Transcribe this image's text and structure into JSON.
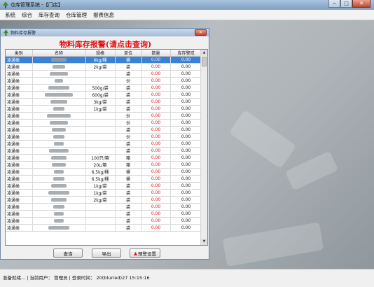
{
  "window": {
    "title": "仓库管理系统 -【门店】",
    "controls": {
      "minimize": "−",
      "maximize": "□",
      "close": "✕"
    }
  },
  "menu": [
    "系统",
    "综合",
    "库存查询",
    "仓库管理",
    "报表信息"
  ],
  "child_window": {
    "title": "物料库存报警",
    "close": "✕",
    "header": "物料库存报警(请点击查询)"
  },
  "table": {
    "columns": [
      "类别",
      "名称",
      "规格",
      "单位",
      "数量",
      "库存警戒"
    ],
    "rows": [
      {
        "cat": "凌通类",
        "name": "(blurred)",
        "spec": "6kg/桶",
        "unit": "桶",
        "qty": "0.00",
        "warn": "0.00",
        "selected": true
      },
      {
        "cat": "凌通类",
        "name": "(blurred)",
        "spec": "2kg/袋",
        "unit": "袋",
        "qty": "0.00",
        "warn": "0.00"
      },
      {
        "cat": "凌通类",
        "name": "(blurred)",
        "spec": "",
        "unit": "袋",
        "qty": "0.00",
        "warn": "0.00"
      },
      {
        "cat": "凌通类",
        "name": "(blurred)",
        "spec": "",
        "unit": "份",
        "qty": "0.00",
        "warn": "0.00"
      },
      {
        "cat": "凌通类",
        "name": "(blurred)",
        "spec": "500g/袋",
        "unit": "袋",
        "qty": "0.00",
        "warn": "0.00"
      },
      {
        "cat": "凌通类",
        "name": "(blurred)",
        "spec": "600g/袋",
        "unit": "袋",
        "qty": "0.00",
        "warn": "0.00"
      },
      {
        "cat": "凌通类",
        "name": "(blurred)",
        "spec": "3kg/袋",
        "unit": "袋",
        "qty": "0.00",
        "warn": "0.00"
      },
      {
        "cat": "凌通类",
        "name": "(blurred)",
        "spec": "1kg/袋",
        "unit": "袋",
        "qty": "0.00",
        "warn": "0.00"
      },
      {
        "cat": "凌通类",
        "name": "(blurred)",
        "spec": "",
        "unit": "份",
        "qty": "0.00",
        "warn": "0.00"
      },
      {
        "cat": "凌通类",
        "name": "(blurred)",
        "spec": "",
        "unit": "份",
        "qty": "0.00",
        "warn": "0.00"
      },
      {
        "cat": "凌通类",
        "name": "(blurred)",
        "spec": "",
        "unit": "袋",
        "qty": "0.00",
        "warn": "0.00"
      },
      {
        "cat": "凌通类",
        "name": "(blurred)",
        "spec": "",
        "unit": "份",
        "qty": "0.00",
        "warn": "0.00"
      },
      {
        "cat": "凌通类",
        "name": "(blurred)",
        "spec": "",
        "unit": "袋",
        "qty": "0.00",
        "warn": "0.00"
      },
      {
        "cat": "凌通类",
        "name": "(blurred)",
        "spec": "",
        "unit": "袋",
        "qty": "0.00",
        "warn": "0.00"
      },
      {
        "cat": "凌通类",
        "name": "(blurred)",
        "spec": "100只/箱",
        "unit": "箱",
        "qty": "0.00",
        "warn": "0.00"
      },
      {
        "cat": "凌通类",
        "name": "(blurred)",
        "spec": "20L/箱",
        "unit": "箱",
        "qty": "0.00",
        "warn": "0.00"
      },
      {
        "cat": "凌通类",
        "name": "(blurred)",
        "spec": "6.5kg/桶",
        "unit": "桶",
        "qty": "0.00",
        "warn": "0.00"
      },
      {
        "cat": "凌通类",
        "name": "(blurred)",
        "spec": "6.5kg/桶",
        "unit": "桶",
        "qty": "0.00",
        "warn": "0.00"
      },
      {
        "cat": "凌通类",
        "name": "(blurred)",
        "spec": "1kg/袋",
        "unit": "袋",
        "qty": "0.00",
        "warn": "0.00"
      },
      {
        "cat": "凌通类",
        "name": "(blurred)",
        "spec": "1kg/袋",
        "unit": "袋",
        "qty": "0.00",
        "warn": "0.00"
      },
      {
        "cat": "凌通类",
        "name": "(blurred)",
        "spec": "2kg/袋",
        "unit": "袋",
        "qty": "0.00",
        "warn": "0.00"
      },
      {
        "cat": "凌通类",
        "name": "(blurred)",
        "spec": "",
        "unit": "袋",
        "qty": "0.00",
        "warn": "0.00"
      },
      {
        "cat": "凌通类",
        "name": "(blurred)",
        "spec": "",
        "unit": "袋",
        "qty": "0.00",
        "warn": "0.00"
      },
      {
        "cat": "凌通类",
        "name": "(blurred)",
        "spec": "",
        "unit": "袋",
        "qty": "0.00",
        "warn": "0.00"
      },
      {
        "cat": "凌通类",
        "name": "(blurred)",
        "spec": "",
        "unit": "袋",
        "qty": "0.00",
        "warn": "0.00"
      }
    ]
  },
  "buttons": {
    "query": "查询",
    "export": "导出",
    "alert_settings": "预警设置"
  },
  "status": "准备就绪... | 当前用户： 管理员 | 登录时间： 20(blurred)27 15:15:16",
  "colors": {
    "accent_red": "#e01010",
    "selected_row": "#3a82d6"
  }
}
